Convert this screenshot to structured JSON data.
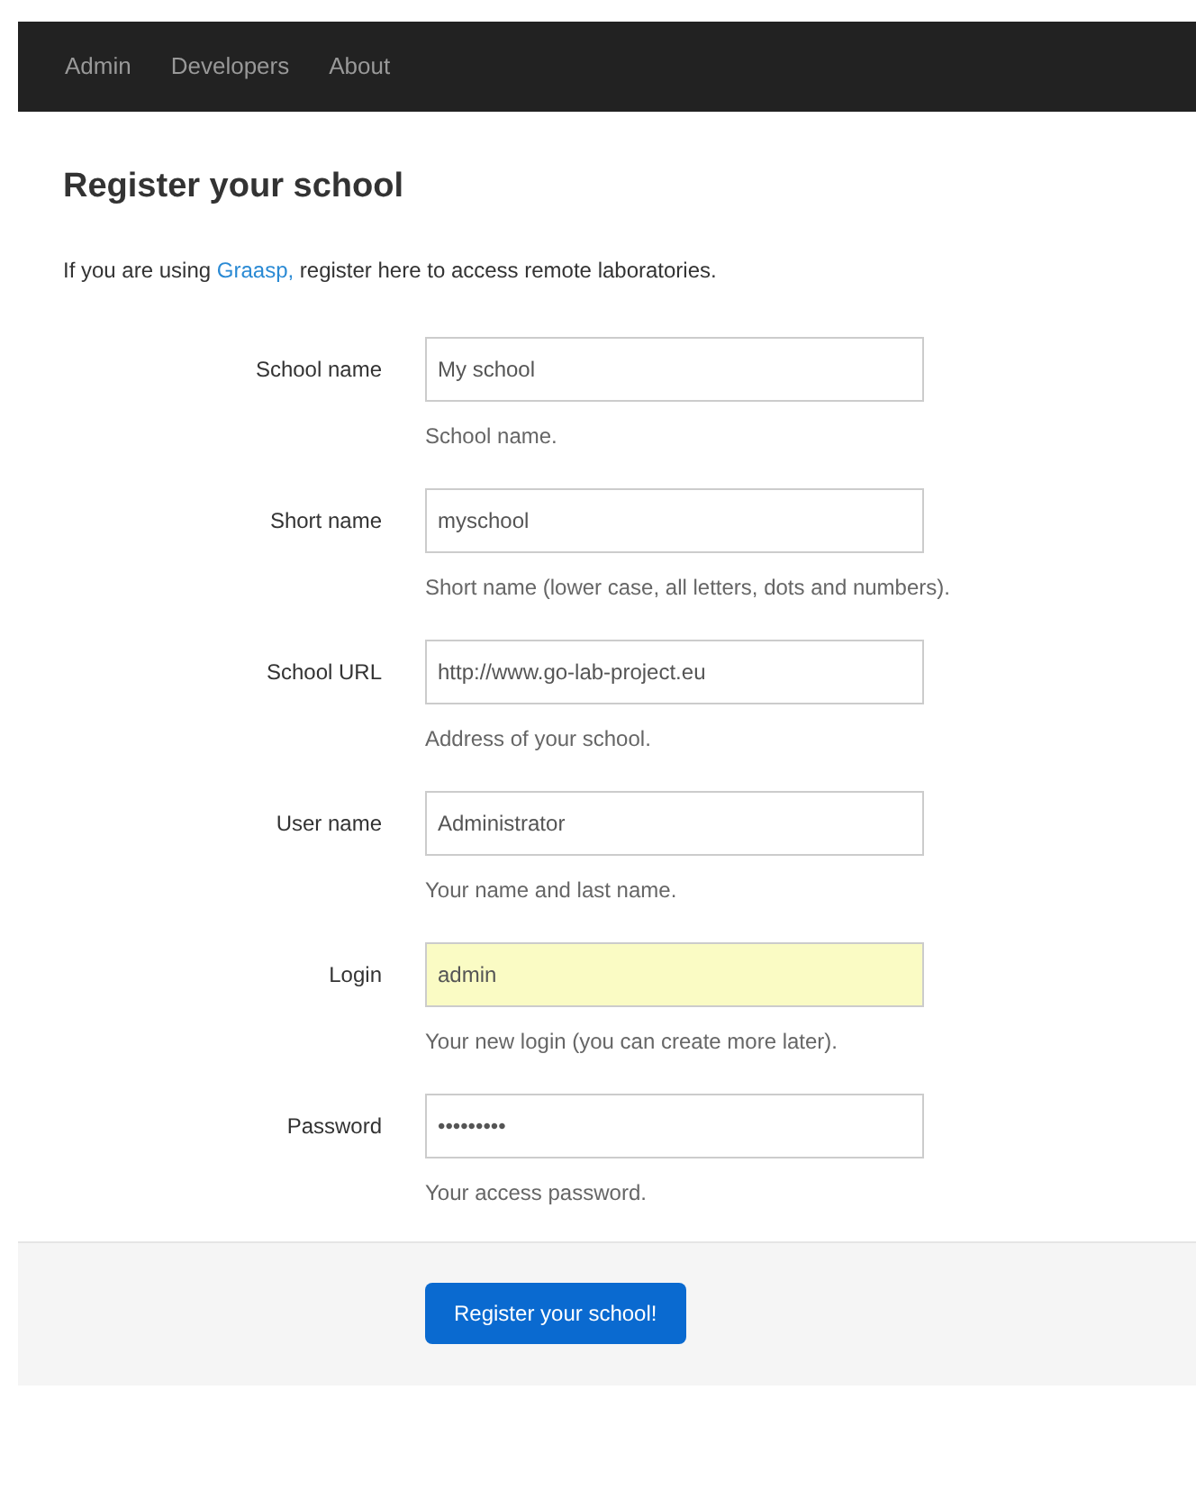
{
  "navbar": {
    "items": [
      "Admin",
      "Developers",
      "About"
    ]
  },
  "title": "Register your school",
  "intro": {
    "before": "If you are using ",
    "link": "Graasp,",
    "after": " register here to access remote laboratories."
  },
  "fields": [
    {
      "label": "School name",
      "value": "My school",
      "help": "School name.",
      "autofilled": false
    },
    {
      "label": "Short name",
      "value": "myschool",
      "help": "Short name (lower case, all letters, dots and numbers).",
      "autofilled": false
    },
    {
      "label": "School URL",
      "value": "http://www.go-lab-project.eu",
      "help": "Address of your school.",
      "autofilled": false
    },
    {
      "label": "User name",
      "value": "Administrator",
      "help": "Your name and last name.",
      "autofilled": false
    },
    {
      "label": "Login",
      "value": "admin",
      "help": "Your new login (you can create more later).",
      "autofilled": true
    },
    {
      "label": "Password",
      "value": "•••••••••",
      "help": "Your access password.",
      "autofilled": false
    }
  ],
  "submit": "Register your school!"
}
